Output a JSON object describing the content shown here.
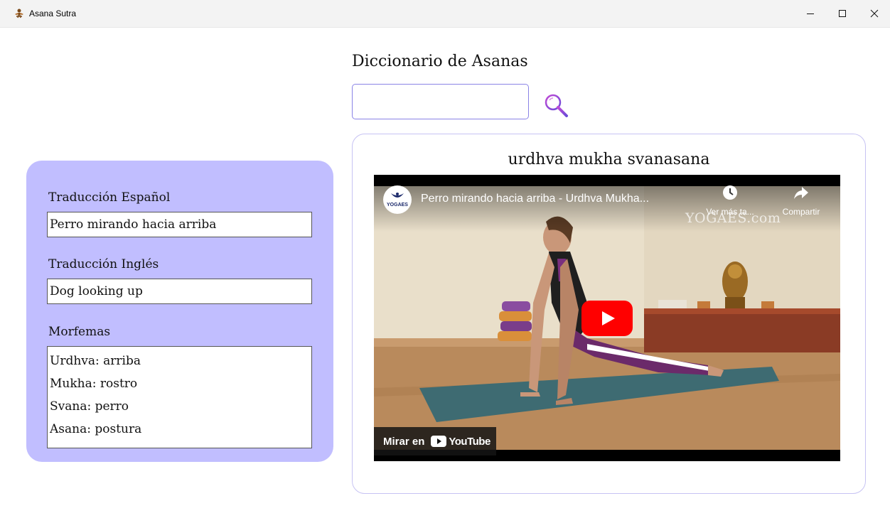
{
  "window": {
    "title": "Asana Sutra",
    "controls": {
      "minimize": "minimize-icon",
      "maximize": "maximize-icon",
      "close": "close-icon"
    }
  },
  "search": {
    "heading": "Diccionario de Asanas",
    "value": "",
    "button_icon": "magnifier-icon"
  },
  "translation": {
    "spanish_label": "Traducción Español",
    "spanish_value": "Perro mirando hacia arriba",
    "english_label": "Traducción Inglés",
    "english_value": "Dog looking up",
    "morphemes_label": "Morfemas",
    "morphemes": [
      "Urdhva: arriba",
      "Mukha: rostro",
      "Svana: perro",
      "Asana: postura"
    ]
  },
  "result": {
    "asana_name": "urdhva mukha svanasana",
    "video": {
      "channel_logo_text": "YOGAES",
      "title": "Perro mirando hacia arriba - Urdhva Mukha...",
      "watch_later": "Ver más ta...",
      "share": "Compartir",
      "watermark": "YOGAES.com",
      "watch_on": "Mirar en",
      "platform": "YouTube"
    }
  },
  "colors": {
    "panel": "#c1beff",
    "accent": "#8a83e6",
    "play_button": "#ff0000"
  }
}
